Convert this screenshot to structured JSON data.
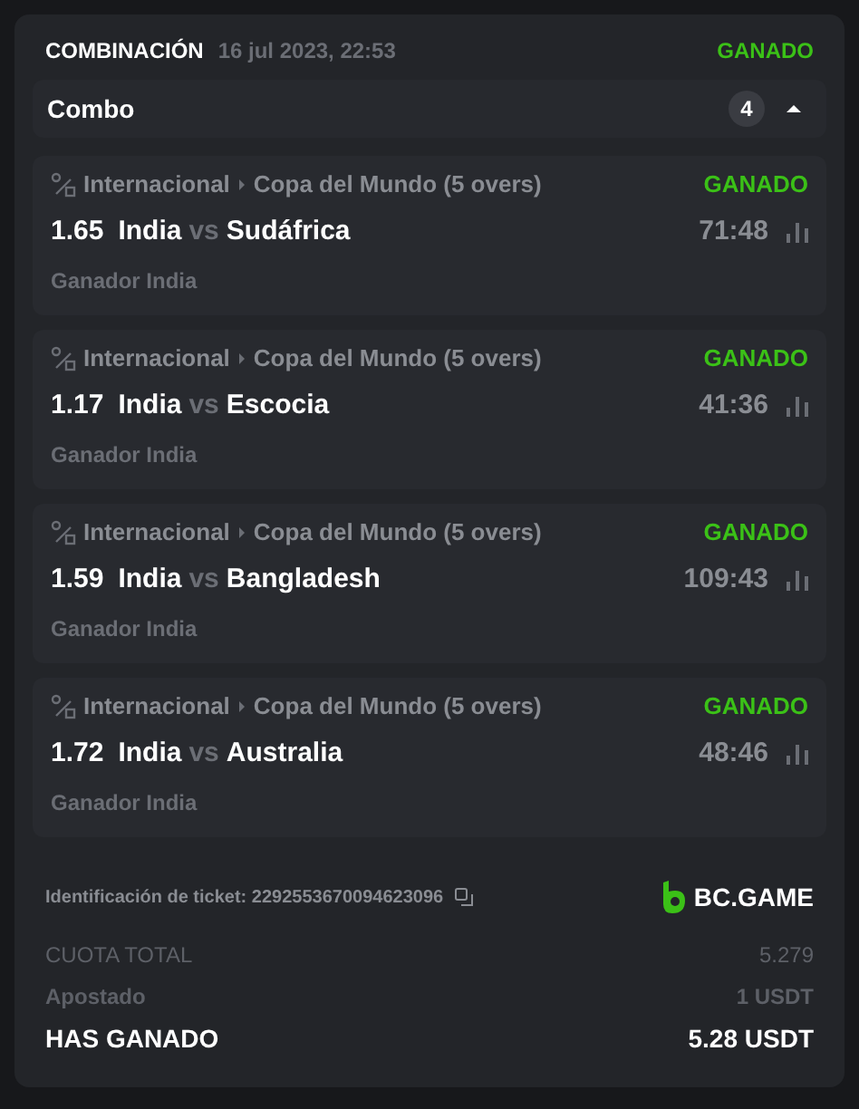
{
  "bet": {
    "type": "COMBINACIÓN",
    "date": "16 jul 2023, 22:53",
    "status": "GANADO"
  },
  "combo": {
    "label": "Combo",
    "count": "4",
    "expanded": true
  },
  "legs": [
    {
      "region": "Internacional",
      "league": "Copa del Mundo (5 overs)",
      "status": "GANADO",
      "odds": "1.65",
      "home": "India",
      "vs": "vs",
      "away": "Sudáfrica",
      "time": "71:48",
      "pick": "Ganador India"
    },
    {
      "region": "Internacional",
      "league": "Copa del Mundo (5 overs)",
      "status": "GANADO",
      "odds": "1.17",
      "home": "India",
      "vs": "vs",
      "away": "Escocia",
      "time": "41:36",
      "pick": "Ganador India"
    },
    {
      "region": "Internacional",
      "league": "Copa del Mundo (5 overs)",
      "status": "GANADO",
      "odds": "1.59",
      "home": "India",
      "vs": "vs",
      "away": "Bangladesh",
      "time": "109:43",
      "pick": "Ganador India"
    },
    {
      "region": "Internacional",
      "league": "Copa del Mundo (5 overs)",
      "status": "GANADO",
      "odds": "1.72",
      "home": "India",
      "vs": "vs",
      "away": "Australia",
      "time": "48:46",
      "pick": "Ganador India"
    }
  ],
  "ticket": {
    "label": "Identificación de ticket: 2292553670094623096",
    "brand": "BC.GAME"
  },
  "summary": [
    {
      "label": "CUOTA TOTAL",
      "value": "5.279",
      "kind": "muted"
    },
    {
      "label": "Apostado",
      "value": "1 USDT",
      "kind": "bold"
    },
    {
      "label": "HAS GANADO",
      "value": "5.28 USDT",
      "kind": "total"
    }
  ]
}
